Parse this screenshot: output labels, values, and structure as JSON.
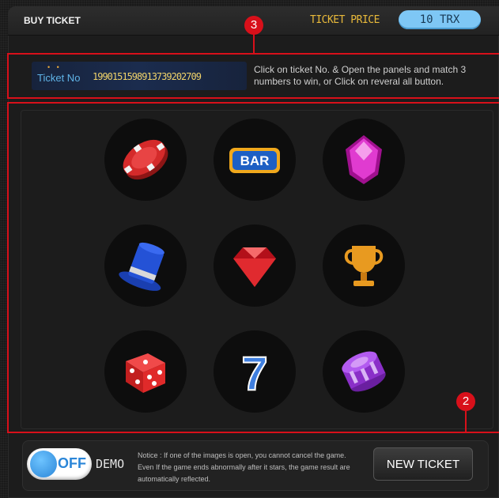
{
  "header": {
    "title": "BUY TICKET",
    "price_label": "TICKET PRICE",
    "price_value": "10 TRX"
  },
  "markers": {
    "m3": "3",
    "m2": "2"
  },
  "ticket": {
    "dots": "• •",
    "label": "Ticket No",
    "number": "1990151598913739202709",
    "instructions": "Click on ticket No. & Open the panels and match 3 numbers to win, or Click on reveral all button."
  },
  "grid": {
    "items": [
      {
        "icon": "casino-chip-icon"
      },
      {
        "icon": "bar-icon",
        "text": "BAR"
      },
      {
        "icon": "purple-gem-icon"
      },
      {
        "icon": "top-hat-icon"
      },
      {
        "icon": "red-diamond-icon"
      },
      {
        "icon": "trophy-icon"
      },
      {
        "icon": "dice-icon"
      },
      {
        "icon": "seven-icon",
        "text": "7"
      },
      {
        "icon": "chip-stack-icon"
      }
    ]
  },
  "footer": {
    "toggle_label": "OFF",
    "demo_label": "DEMO",
    "notice": "Notice : If one of the images is open, you cannot cancel the game. Even If the game ends abnormally after it stars, the game result are automatically reflected.",
    "new_ticket": "NEW TICKET"
  },
  "colors": {
    "accent_red": "#d8101a",
    "price_pill": "#7ec7f5",
    "toggle_blue": "#2b86d8",
    "ticket_number": "#f0d36a"
  }
}
